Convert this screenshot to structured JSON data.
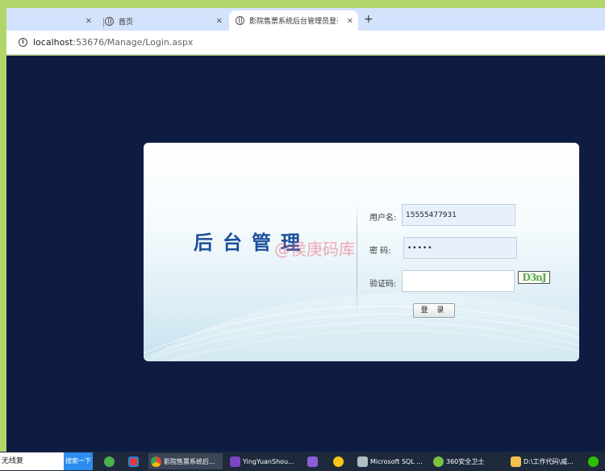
{
  "browser": {
    "tabs": [
      {
        "label": "",
        "close": "×"
      },
      {
        "label": "首页",
        "close": "×"
      },
      {
        "label": "影院售票系统后台管理员登录",
        "close": "×"
      }
    ],
    "new_tab": "+",
    "url_host": "localhost",
    "url_rest": ":53676/Manage/Login.aspx"
  },
  "login": {
    "title": "后台管理",
    "watermark": "@侯庚码库",
    "username_label": "用户名:",
    "username_value": "15555477931",
    "password_label": "密 码:",
    "password_value": "•••••",
    "code_label": "验证码:",
    "code_value": "",
    "captcha_text": "D3nJ",
    "submit_label": "登 录"
  },
  "taskbar": {
    "search_text": "无线复",
    "search_button": "搜索一下",
    "items": [
      {
        "label": "影院售票系统后..."
      },
      {
        "label": "YingYuanShou..."
      },
      {
        "label": "Microsoft SQL ..."
      },
      {
        "label": "360安全卫士"
      },
      {
        "label": "D:\\工作代码\\威..."
      }
    ]
  },
  "colors": {
    "page_bg": "#0f1c42",
    "title": "#1d4f99",
    "accent": "#2d8cf0"
  }
}
